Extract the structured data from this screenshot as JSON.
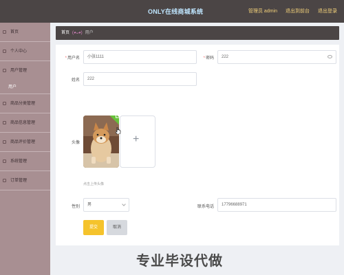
{
  "app": {
    "title": "ONLY在线商城系统"
  },
  "header": {
    "admin_label": "管理员 admin",
    "back_to_front": "退出到前台",
    "logout": "退出登录"
  },
  "sidebar": {
    "items": [
      {
        "label": "首页"
      },
      {
        "label": "个人中心"
      },
      {
        "label": "用户管理"
      },
      {
        "label": "用户"
      },
      {
        "label": "商品分类管理"
      },
      {
        "label": "商品信息管理"
      },
      {
        "label": "商品评价管理"
      },
      {
        "label": "系统管理"
      },
      {
        "label": "订单管理"
      }
    ]
  },
  "breadcrumb": {
    "home": "首页",
    "sep": "(◕ᴗ◕)",
    "current": "用户"
  },
  "form": {
    "username": {
      "label": "用户名",
      "value": "小张1111"
    },
    "password": {
      "label": "密码",
      "value": "222"
    },
    "name": {
      "label": "姓名",
      "value": "222"
    },
    "avatar": {
      "label": "头像",
      "hint": "点击上传头像",
      "plus": "+"
    },
    "gender": {
      "label": "性别",
      "value": "男"
    },
    "phone": {
      "label": "联系电话",
      "value": "17796688971"
    },
    "submit": "提交",
    "cancel": "取消",
    "required_mark": "*"
  },
  "watermark": "专业毕设代做",
  "colors": {
    "topbar": "#4b4545",
    "sidebar": "#a88f92",
    "submit": "#f5c32c",
    "success": "#67c23a"
  }
}
